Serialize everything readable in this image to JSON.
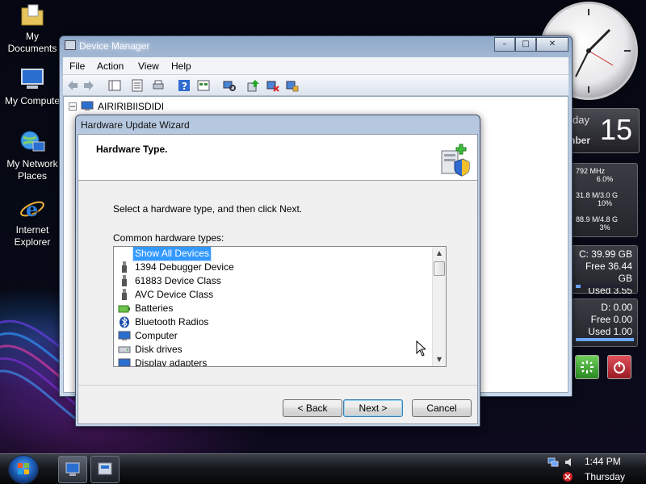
{
  "desktop": {
    "icons": [
      {
        "label_line1": "My",
        "label_line2": "Documents"
      },
      {
        "label_line1": "My Compute",
        "label_line2": ""
      },
      {
        "label_line1": "My Network",
        "label_line2": "Places"
      },
      {
        "label_line1": "Internet",
        "label_line2": "Explorer"
      }
    ]
  },
  "gadgets": {
    "calendar": {
      "day": "day",
      "month": "nber",
      "date": "15"
    },
    "cpu": [
      {
        "top": "792 MHz",
        "bottom": "6.0%"
      },
      {
        "top": "31.8 M/3.0 G",
        "bottom": "10%"
      },
      {
        "top": "88.9 M/4.8 G",
        "bottom": "3%"
      }
    ],
    "drives": [
      {
        "line1": "C: 39.99 GB",
        "line2": "Free 36.44 GB",
        "line3": "Used 3.55 GB",
        "used_fraction": 0.09
      },
      {
        "line1": "D: 0.00",
        "line2": "Free 0.00",
        "line3": "Used 1.00",
        "used_fraction": 1.0
      }
    ]
  },
  "device_manager": {
    "title": "Device Manager",
    "menu": [
      "File",
      "Action",
      "View",
      "Help"
    ],
    "tree_root": "AIRIRIBIISDIDI"
  },
  "wizard": {
    "title": "Hardware Update Wizard",
    "header_title": "Hardware Type.",
    "instruction": "Select a hardware type, and then click Next.",
    "list_label": "Common hardware types:",
    "items": [
      "Show All Devices",
      "1394 Debugger Device",
      "61883 Device Class",
      "AVC Device Class",
      "Batteries",
      "Bluetooth Radios",
      "Computer",
      "Disk drives",
      "Display adapters"
    ],
    "selected_index": 0,
    "buttons": {
      "back": "< Back",
      "next": "Next >",
      "cancel": "Cancel"
    }
  },
  "taskbar": {
    "time": "1:44 PM",
    "day": "Thursday"
  },
  "colors": {
    "selection": "#3399ff",
    "accent_blue": "#3c7fb1"
  }
}
